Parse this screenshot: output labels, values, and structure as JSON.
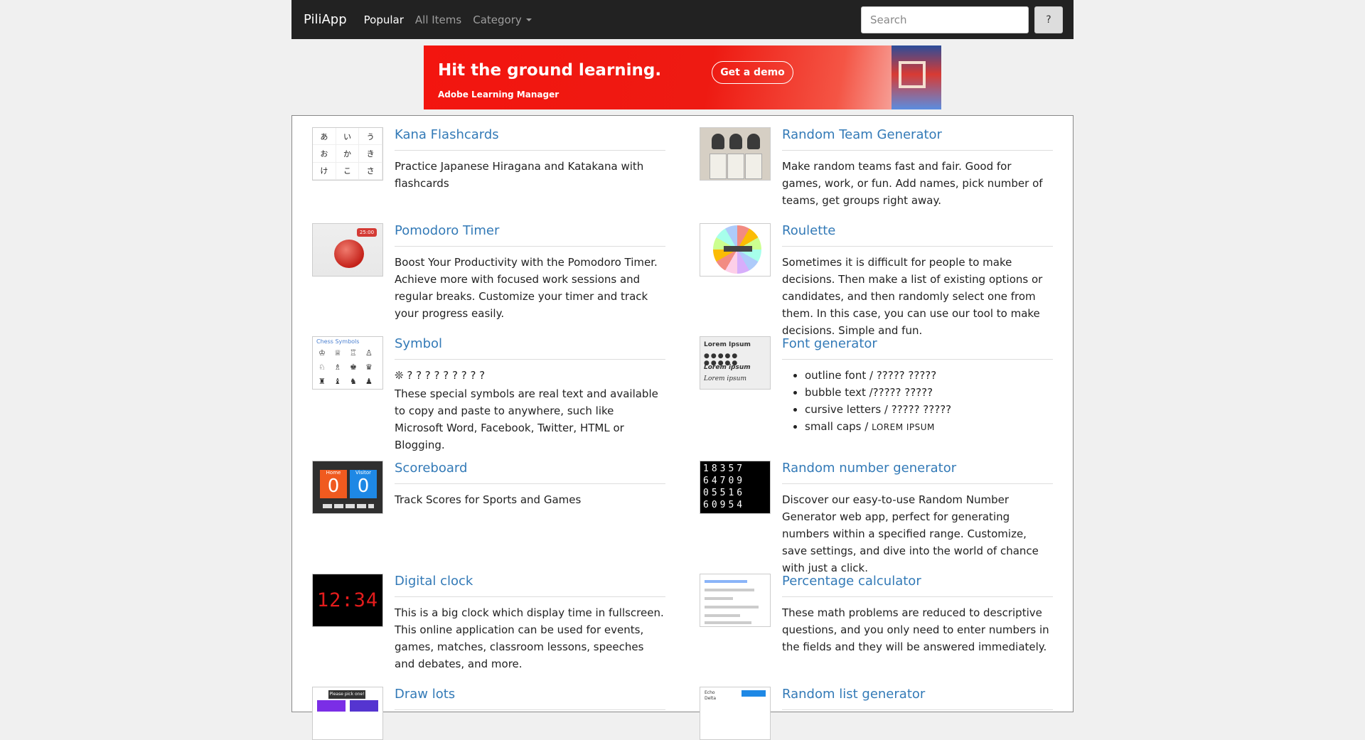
{
  "navbar": {
    "brand": "PiliApp",
    "links": [
      "Popular",
      "All Items",
      "Category"
    ],
    "search_placeholder": "Search",
    "search_button": "?"
  },
  "ad": {
    "headline": "Hit the ground learning.",
    "brand": "Adobe Learning Manager",
    "cta": "Get a demo"
  },
  "items": [
    {
      "title": "Kana Flashcards",
      "desc": "Practice Japanese Hiragana and Katakana with flashcards",
      "thumb_chars": [
        "あ",
        "い",
        "う",
        "お",
        "か",
        "き",
        "け",
        "こ",
        "さ"
      ]
    },
    {
      "title": "Random Team Generator",
      "desc": "Make random teams fast and fair. Good for games, work, or fun. Add names, pick number of teams, get groups right away."
    },
    {
      "title": "Pomodoro Timer",
      "desc": "Boost Your Productivity with the Pomodoro Timer. Achieve more with focused work sessions and regular breaks. Customize your timer and track your progress easily.",
      "thumb_badge": "25:00"
    },
    {
      "title": "Roulette",
      "desc": "Sometimes it is difficult for people to make decisions. Then make a list of existing options or candidates, and then randomly select one from them. In this case, you can use our tool to make decisions. Simple and fun."
    },
    {
      "title": "Symbol",
      "symbols_line": "❊ ? ? ? ? ? ? ? ? ?",
      "desc": "These special symbols are real text and available to copy and paste to anywhere, such like Microsoft Word, Facebook, Twitter, HTML or Blogging.",
      "thumb_label": "Chess Symbols"
    },
    {
      "title": "Font generator",
      "bullets": [
        "outline font / ????? ?????",
        "bubble text /?????  ?????",
        "cursive letters / ????? ?????"
      ],
      "smallcaps_prefix": "small caps / ",
      "smallcaps_sample": "lorem ipsum",
      "thumb_label": "Lorem Ipsum"
    },
    {
      "title": "Scoreboard",
      "desc": "Track Scores for Sports and Games",
      "thumb_home": "Home",
      "thumb_visitor": "Visitor",
      "thumb_home_score": "0",
      "thumb_visitor_score": "0"
    },
    {
      "title": "Random number generator",
      "desc": "Discover our easy-to-use Random Number Generator web app, perfect for generating numbers within a specified range. Customize, save settings, and dive into the world of chance with just a click.",
      "thumb_rows": [
        "18357",
        "64709",
        "05516",
        "60954"
      ]
    },
    {
      "title": "Digital clock",
      "desc": "This is a big clock which display time in fullscreen. This online application can be used for events, games, matches, classroom lessons, speeches and debates, and more.",
      "thumb_time": "12:34"
    },
    {
      "title": "Percentage calculator",
      "desc": "These math problems are reduced to descriptive questions, and you only need to enter numbers in the fields and they will be answered immediately."
    },
    {
      "title": "Draw lots",
      "thumb_tag": "Please pick one!"
    },
    {
      "title": "Random list generator",
      "thumb_lines": "Echo\nDelta"
    }
  ]
}
